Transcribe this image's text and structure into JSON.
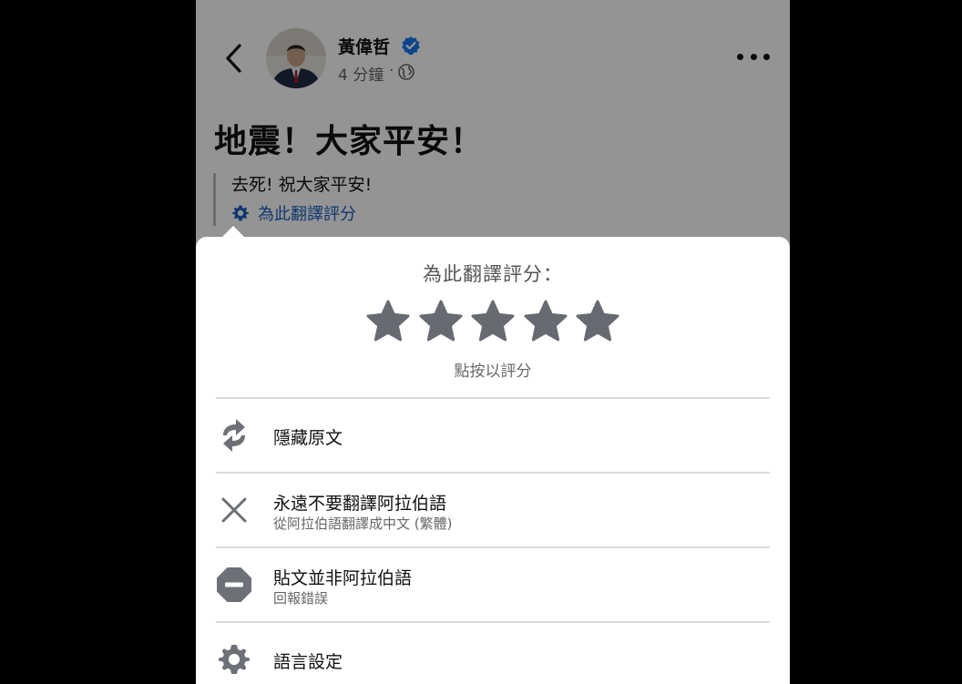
{
  "post": {
    "author": "黃偉哲",
    "time": "4 分鐘",
    "dot": "·",
    "text": "地震！大家平安！",
    "translation": "去死! 祝大家平安!",
    "rate_link": "為此翻譯評分"
  },
  "sheet": {
    "title": "為此翻譯評分：",
    "stars_count": 5,
    "hint": "點按以評分",
    "items": [
      {
        "label": "隱藏原文",
        "icon": "swap-arrows-icon"
      },
      {
        "label": "永遠不要翻譯阿拉伯語",
        "sub": "從阿拉伯語翻譯成中文 (繁體)",
        "icon": "close-x-icon"
      },
      {
        "label": "貼文並非阿拉伯語",
        "sub": "回報錯誤",
        "icon": "minus-circle-icon"
      },
      {
        "label": "語言設定",
        "icon": "gear-icon"
      }
    ]
  },
  "colors": {
    "link_blue": "#1a5fc0",
    "verified_blue": "#1877f2",
    "star_gray": "#676a70",
    "icon_gray": "#6d7077"
  }
}
